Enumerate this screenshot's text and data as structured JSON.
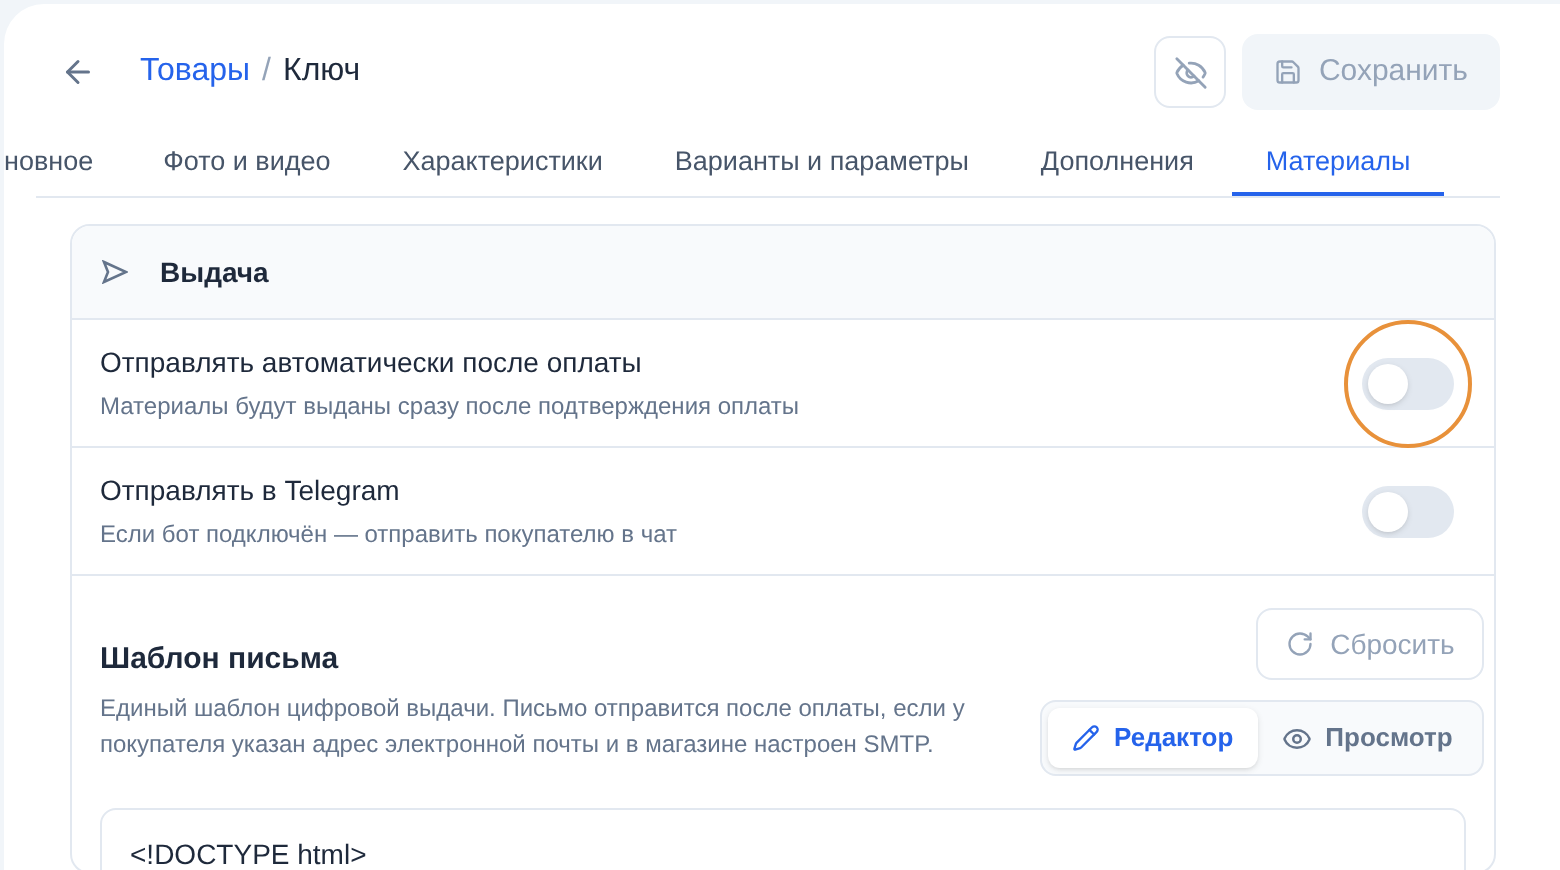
{
  "breadcrumb": {
    "parent": "Товары",
    "separator": "/",
    "current": "Ключ"
  },
  "header_buttons": {
    "save": {
      "label": "Сохранить",
      "disabled": true
    }
  },
  "tabs": [
    {
      "label": "новное",
      "selected": false
    },
    {
      "label": "Фото и видео",
      "selected": false
    },
    {
      "label": "Характеристики",
      "selected": false
    },
    {
      "label": "Варианты и параметры",
      "selected": false
    },
    {
      "label": "Дополнения",
      "selected": false
    },
    {
      "label": "Материалы",
      "selected": true
    }
  ],
  "section": {
    "title": "Выдача",
    "settings": [
      {
        "title": "Отправлять автоматически после оплаты",
        "description": "Материалы будут выданы сразу после подтверждения оплаты",
        "on": false,
        "highlighted": true
      },
      {
        "title": "Отправлять в Telegram",
        "description": "Если бот подключён — отправить покупателю в чат",
        "on": false,
        "highlighted": false
      }
    ],
    "template": {
      "title": "Шаблон письма",
      "description": "Единый шаблон цифровой выдачи. Письмо отправится после оплаты, если у покупателя указан адрес электронной почты и в магазине настроен SMTP.",
      "reset_label": "Сбросить",
      "modes": [
        {
          "label": "Редактор",
          "kind": "edit",
          "selected": true
        },
        {
          "label": "Просмотр",
          "kind": "preview",
          "selected": false
        }
      ],
      "code_lines": [
        "<!DOCTYPE html>"
      ]
    }
  }
}
